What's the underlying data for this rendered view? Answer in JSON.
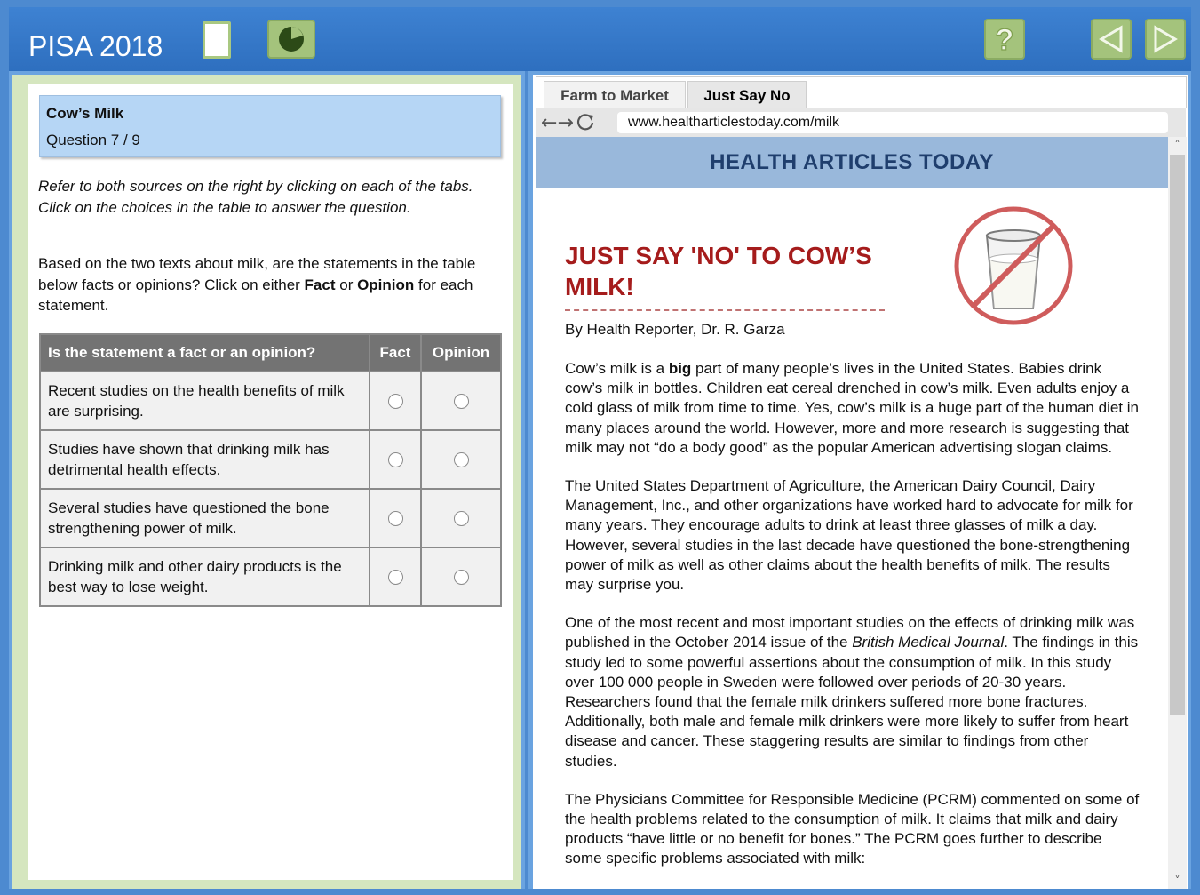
{
  "header": {
    "title": "PISA 2018"
  },
  "question": {
    "title": "Cow’s Milk",
    "number": "Question 7 / 9",
    "instructions": "Refer to both sources on the right by clicking on each of the tabs. Click on the choices in the table to answer the question.",
    "prompt_part1": "Based on the two texts about milk, are the statements in the table below facts or opinions? Click on either ",
    "prompt_fact": "Fact",
    "prompt_or": " or ",
    "prompt_opinion": "Opinion",
    "prompt_part2": " for each statement.",
    "table": {
      "headers": [
        "Is the statement a fact or an opinion?",
        "Fact",
        "Opinion"
      ],
      "rows": [
        "Recent studies on the health benefits of milk are surprising.",
        "Studies have shown that drinking milk has detrimental health effects.",
        "Several studies have questioned the bone strengthening power of milk.",
        "Drinking milk and other dairy products is the best way to lose weight."
      ]
    }
  },
  "browser": {
    "tabs": [
      "Farm to Market",
      "Just Say No"
    ],
    "url": "www.healtharticlestoday.com/milk",
    "site_title": "HEALTH ARTICLES TODAY",
    "article_title": "JUST SAY 'NO' TO COW’S MILK!",
    "byline": "By Health Reporter, Dr. R. Garza",
    "p1_a": "Cow’s milk is a ",
    "p1_bold": "big",
    "p1_b": " part of many people’s lives in the United States. Babies drink cow’s milk in bottles. Children eat cereal drenched in cow’s milk. Even adults enjoy a cold glass of milk from time to time. Yes, cow’s milk is a huge part of the human diet in many places around the world. However, more and more research is suggesting that milk may not “do a body good” as the popular American advertising slogan claims.",
    "p2": "The United States Department of Agriculture, the American Dairy Council, Dairy Management, Inc., and other organizations have worked hard to advocate for milk for many years. They encourage adults to drink at least three glasses of milk a day. However, several studies in the last decade have questioned the bone-strengthening power of milk as well as other claims about the health benefits of milk. The results may surprise you.",
    "p3_a": "One of the most recent and most important studies on the effects of drinking milk was published in the October 2014 issue of the ",
    "p3_italic": "British Medical Journal",
    "p3_b": ". The findings in this study led to some powerful assertions about the consumption of milk. In this study over 100 000 people in Sweden were followed over periods of 20-30 years. Researchers found that the female milk drinkers suffered more bone fractures. Additionally, both male and female milk drinkers were more likely to suffer from heart disease and cancer. These staggering results are similar to findings from other studies.",
    "p4": "The Physicians Committee for Responsible Medicine (PCRM) commented on some of the health problems related to the consumption of milk. It claims that milk and dairy products “have little or no benefit for bones.” The PCRM goes further to describe some specific problems associated with milk:"
  },
  "icons": {
    "doc": "document-icon",
    "timer": "timer-icon",
    "help": "question-mark-icon",
    "back": "arrow-left-icon",
    "next": "arrow-right-icon",
    "refresh": "refresh-icon",
    "no_milk": "no-milk-icon"
  },
  "colors": {
    "header_blue": "#3e82d2",
    "accent_green": "#a4c37c",
    "title_red": "#a51c1c",
    "banner_blue": "#99b8db"
  }
}
